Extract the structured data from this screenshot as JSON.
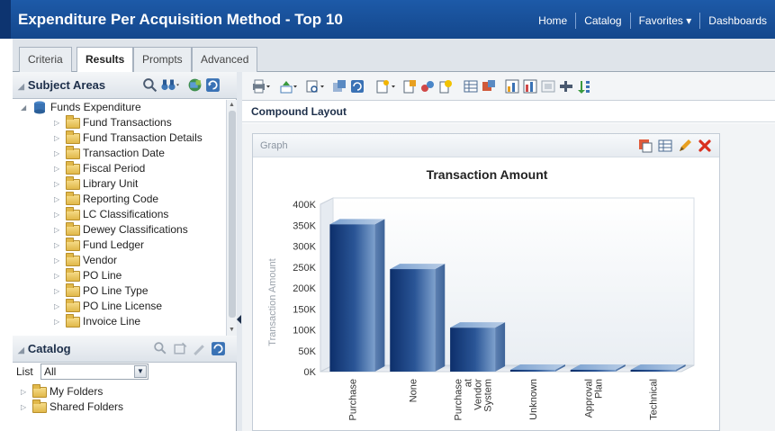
{
  "header": {
    "title": "Expenditure Per Acquisition Method - Top 10",
    "nav": [
      "Home",
      "Catalog",
      "Favorites ▾",
      "Dashboards"
    ]
  },
  "tabs": [
    "Criteria",
    "Results",
    "Prompts",
    "Advanced"
  ],
  "active_tab": "Results",
  "subject_areas": {
    "title": "Subject Areas",
    "root": "Funds Expenditure",
    "folders": [
      "Fund Transactions",
      "Fund Transaction Details",
      "Transaction Date",
      "Fiscal Period",
      "Library Unit",
      "Reporting Code",
      "LC Classifications",
      "Dewey Classifications",
      "Fund Ledger",
      "Vendor",
      "PO Line",
      "PO Line Type",
      "PO Line License",
      "Invoice Line"
    ]
  },
  "catalog": {
    "title": "Catalog",
    "list_label": "List",
    "list_value": "All",
    "folders": [
      "My Folders",
      "Shared Folders"
    ]
  },
  "layout": {
    "compound_title": "Compound Layout",
    "view_title": "Graph"
  },
  "colors": {
    "accent": "#1d5aa8",
    "bar_dark": "#0d2f6b",
    "bar_light": "#6a8fc2",
    "delete": "#d9301e"
  },
  "chart_data": {
    "type": "bar",
    "title": "Transaction Amount",
    "ylabel": "Transaction Amount",
    "xlabel": "",
    "categories": [
      "Purchase",
      "None",
      "Purchase at Vendor System",
      "Unknown",
      "Approval Plan",
      "Technical"
    ],
    "category_lines": [
      [
        "Purchase"
      ],
      [
        "None"
      ],
      [
        "Purchase",
        "at",
        "Vendor",
        "System"
      ],
      [
        "Unknown"
      ],
      [
        "Approval",
        "Plan"
      ],
      [
        "Technical"
      ]
    ],
    "values": [
      352000,
      245000,
      105000,
      3000,
      1000,
      500
    ],
    "ylim": [
      0,
      400000
    ],
    "yticks": [
      "0K",
      "50K",
      "100K",
      "150K",
      "200K",
      "250K",
      "300K",
      "350K",
      "400K"
    ],
    "grid": false,
    "legend": "none"
  }
}
